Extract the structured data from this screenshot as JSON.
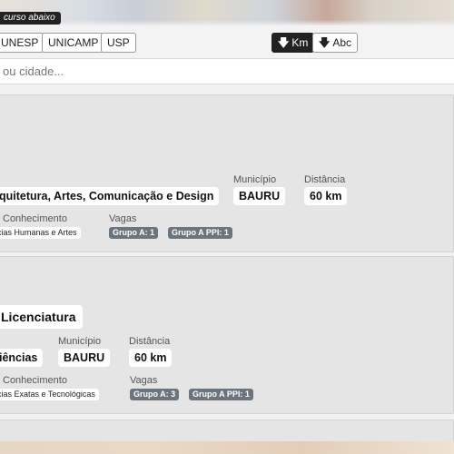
{
  "hero": {
    "hint": "curso abaixo"
  },
  "filters": {
    "universities": [
      "UNESP",
      "UNICAMP",
      "USP"
    ],
    "sort_km": "Km",
    "sort_abc": "Abc"
  },
  "search": {
    "placeholder": "ou cidade..."
  },
  "labels": {
    "municipio": "Município",
    "distancia": "Distância",
    "conhecimento": "Conhecimento",
    "vagas": "Vagas"
  },
  "results": [
    {
      "course_area": "quitetura, Artes, Comunicação e Design",
      "municipio": "BAURU",
      "distancia": "60 km",
      "conhecimento": "cias Humanas e Artes",
      "vagas": [
        "Grupo A: 1",
        "Grupo A PPI: 1"
      ]
    },
    {
      "course_title": "Licenciatura",
      "course_area": "iências",
      "municipio": "BAURU",
      "distancia": "60 km",
      "conhecimento": "cias Exatas e Tecnológicas",
      "vagas": [
        "Grupo A: 3",
        "Grupo A PPI: 1"
      ]
    }
  ]
}
